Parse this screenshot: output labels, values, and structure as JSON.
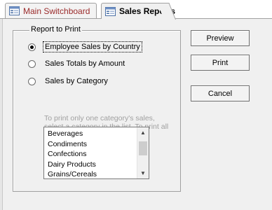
{
  "tabs": [
    {
      "label": "Main Switchboard",
      "active": false,
      "icon": "form-icon"
    },
    {
      "label": "Sales Reports",
      "active": true,
      "icon": "form-icon"
    }
  ],
  "report_group": {
    "title": "Report to Print",
    "options": [
      {
        "label": "Employee Sales by Country",
        "selected": true
      },
      {
        "label": "Sales Totals by Amount",
        "selected": false
      },
      {
        "label": "Sales by Category",
        "selected": false
      }
    ],
    "hint": "To print only one category's sales, select a category in the list. To print all categories, make no selection."
  },
  "category_list": {
    "items": [
      "Beverages",
      "Condiments",
      "Confections",
      "Dairy Products",
      "Grains/Cereals"
    ]
  },
  "buttons": {
    "preview": "Preview",
    "print": "Print",
    "cancel": "Cancel"
  },
  "colors": {
    "inactive_tab_text": "#9a2a2a",
    "form_background": "#f0f0f0",
    "hint_text": "#a0a0a0"
  }
}
